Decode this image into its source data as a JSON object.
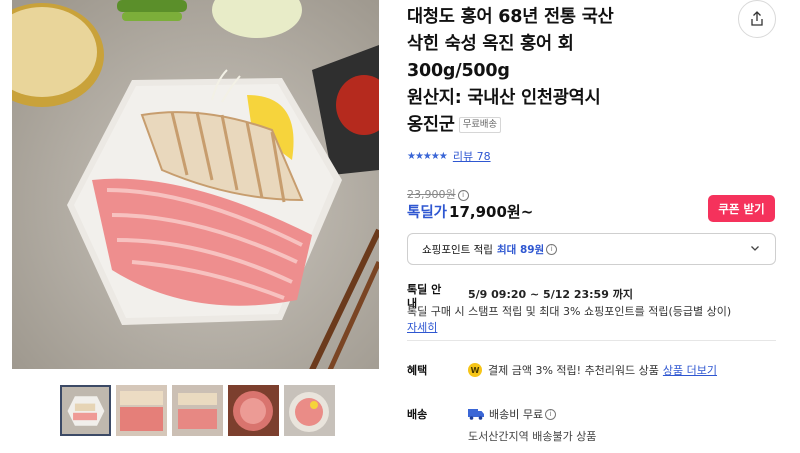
{
  "product": {
    "title_line1": "대청도 홍어 68년 전통 국산",
    "title_line2": "삭힌 숙성 옥진 홍어 회",
    "title_line3": "300g/500g",
    "title_line4": "원산지: 국내산 인천광역시",
    "title_line5": "옹진군",
    "free_shipping_badge": "무료배송"
  },
  "rating": {
    "stars": "★★★★★",
    "review_label": "리뷰 78"
  },
  "price": {
    "original": "23,900원",
    "label": "톡딜가",
    "value": "17,900원~",
    "coupon_button": "쿠폰 받기"
  },
  "points": {
    "label": "쇼핑포인트 적립",
    "highlight": "최대 89원"
  },
  "deal": {
    "label": "톡딜 안내",
    "period": "5/9 09:20 ~ 5/12 23:59 까지",
    "description": "톡딜 구매 시 스탬프 적립 및 최대 3% 쇼핑포인트를 적립(등급별 상이)",
    "more_link": "자세히"
  },
  "benefit": {
    "label": "혜택",
    "icon_text": "W",
    "text": "결제 금액 3% 적립! 추천리워드 상품",
    "link": "상품 더보기"
  },
  "shipping": {
    "label": "배송",
    "fee": "배송비 무료",
    "note": "도서산간지역 배송불가 상품"
  },
  "icons": {
    "share": "share-icon",
    "chevron": "chevron-down-icon",
    "truck": "truck-icon",
    "info": "info-icon"
  },
  "colors": {
    "accent_blue": "#2f57d1",
    "coupon_red": "#f5325c",
    "point_yellow": "#f6c518"
  }
}
